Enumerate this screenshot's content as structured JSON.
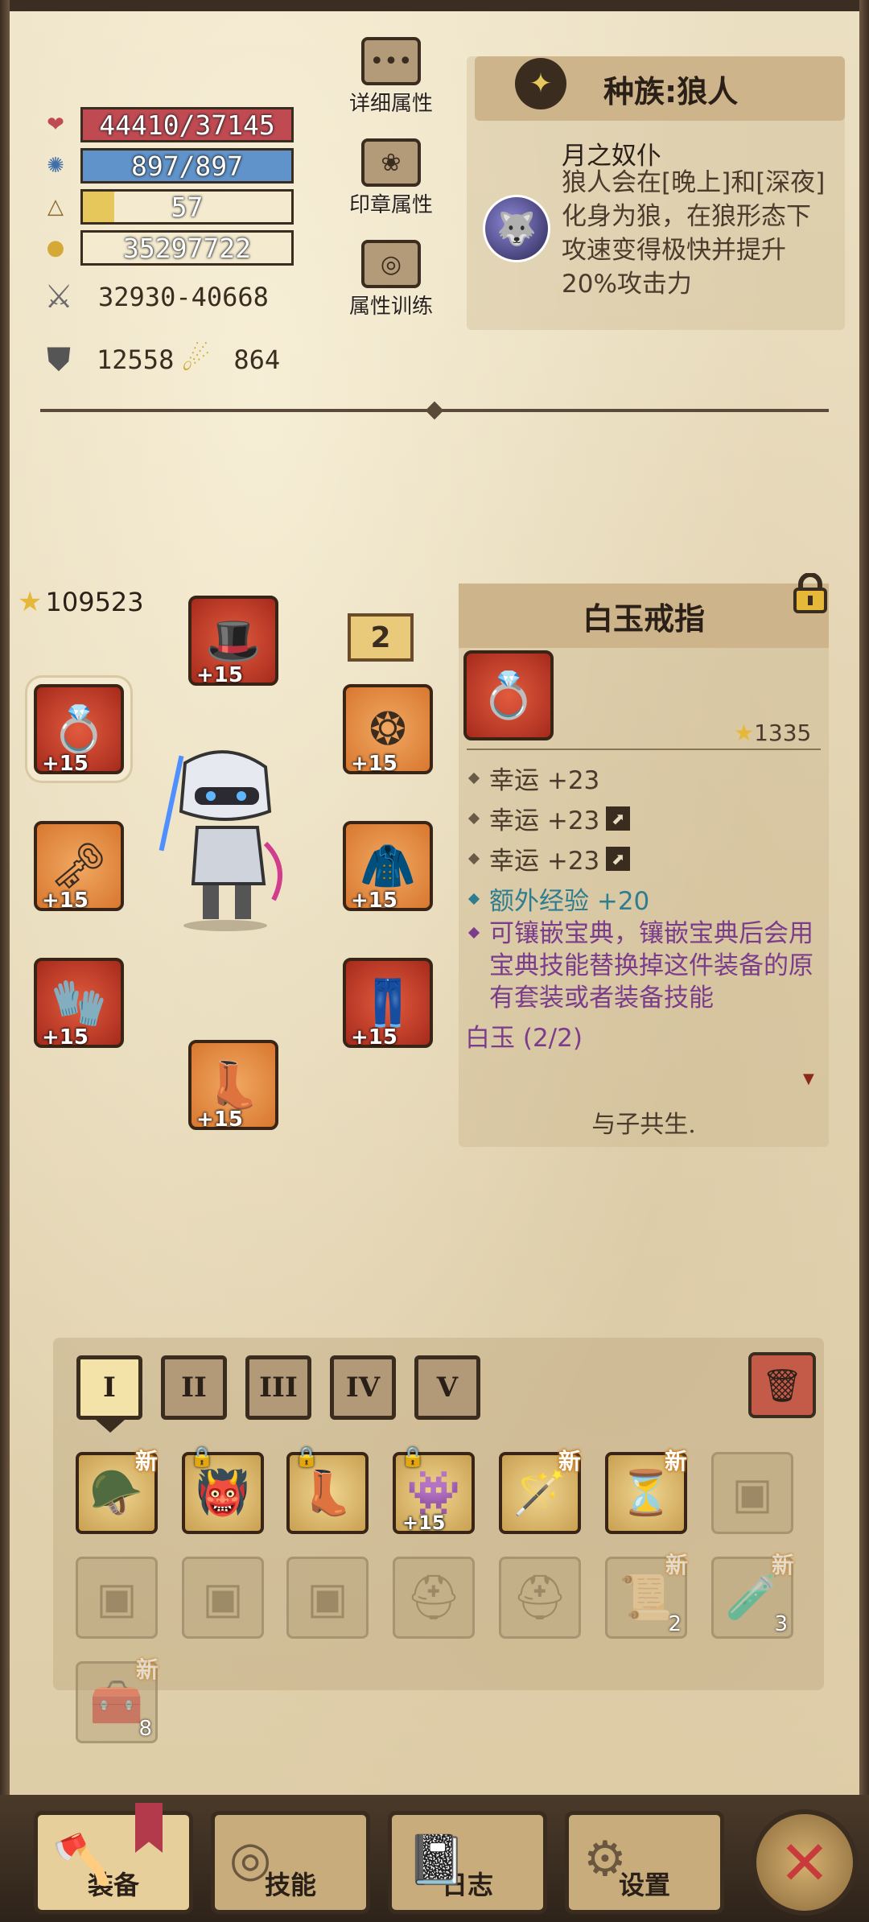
{
  "stats": {
    "hp": "44410/37145",
    "mp": "897/897",
    "level": "57",
    "level_progress": 0.15,
    "gold": "35297722",
    "attack": "32930-40668",
    "defense": "12558",
    "crit": "864"
  },
  "menu": {
    "detail": "详细属性",
    "seal": "印章属性",
    "training": "属性训练"
  },
  "race": {
    "title": "种族:狼人",
    "skill_name": "月之奴仆",
    "skill_desc": "狼人会在[晚上]和[深夜]化身为狼，在狼形态下攻速变得极快并提升20%攻击力"
  },
  "equip": {
    "score": "109523",
    "badge": "2",
    "slots": [
      {
        "name": "helmet",
        "level": "+15"
      },
      {
        "name": "ring-left",
        "level": "+15"
      },
      {
        "name": "amulet",
        "level": "+15"
      },
      {
        "name": "weapon",
        "level": "+15"
      },
      {
        "name": "armor",
        "level": "+15"
      },
      {
        "name": "gloves",
        "level": "+15"
      },
      {
        "name": "pants",
        "level": "+15"
      },
      {
        "name": "boots",
        "level": "+15"
      }
    ]
  },
  "item": {
    "name": "白玉戒指",
    "score": "1335",
    "attrs": [
      {
        "text": "幸运 +23"
      },
      {
        "text": "幸运 +23"
      },
      {
        "text": "幸运 +23"
      },
      {
        "text": "额外经验 +20"
      }
    ],
    "inlay_note": "可镶嵌宝典，镶嵌宝典后会用宝典技能替换掉这件装备的原有套装或者装备技能",
    "set": "白玉 (2/2)",
    "motto": "与子共生."
  },
  "inventory": {
    "tabs": [
      "I",
      "II",
      "III",
      "IV",
      "V"
    ],
    "new_label": "新",
    "row1": [
      {
        "icon": "hood-icon",
        "new": true,
        "locked": false,
        "plus": ""
      },
      {
        "icon": "maw-icon",
        "new": false,
        "locked": true,
        "plus": ""
      },
      {
        "icon": "boots-icon",
        "new": false,
        "locked": true,
        "plus": ""
      },
      {
        "icon": "monster-icon",
        "new": false,
        "locked": true,
        "plus": "+15"
      },
      {
        "icon": "wand-icon",
        "new": true,
        "locked": false,
        "plus": ""
      },
      {
        "icon": "hourglass-icon",
        "new": true,
        "locked": false,
        "plus": ""
      }
    ],
    "counts": {
      "slot12": "2",
      "slot13": "3",
      "slot14": "8"
    }
  },
  "nav": {
    "equip": "装备",
    "skills": "技能",
    "log": "日志",
    "settings": "设置"
  },
  "colors": {
    "hp": "#c04a52",
    "mp": "#5f93c9",
    "level_fill": "#e6c75b",
    "slot_orange": "#d8772f",
    "slot_red": "#a52a1c",
    "teal": "#2f7d8f",
    "purple": "#7b3c8c"
  }
}
